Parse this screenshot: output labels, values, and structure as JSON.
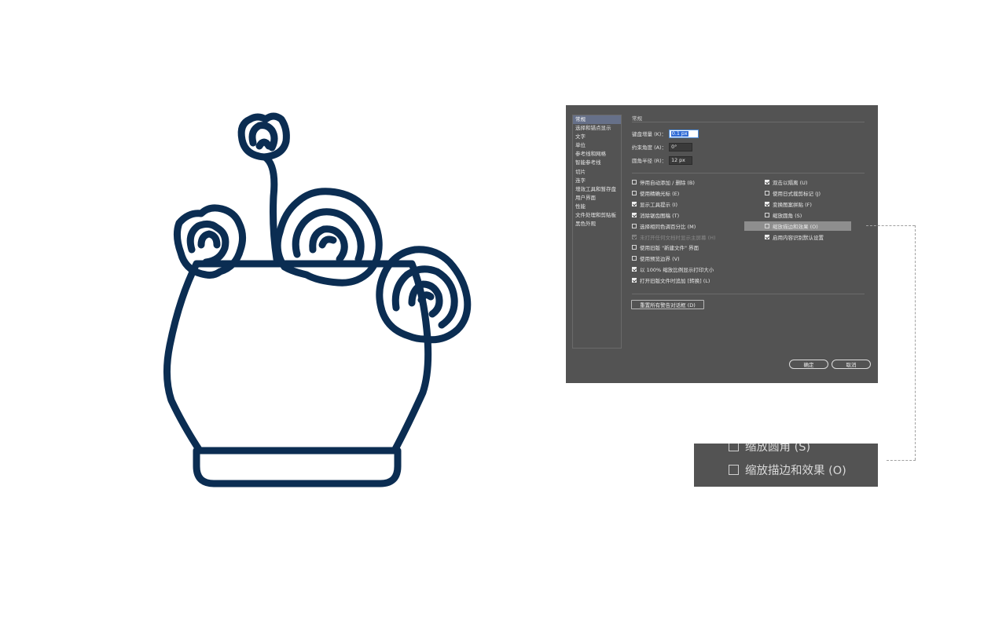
{
  "dialog": {
    "categories": [
      {
        "label": "常规",
        "selected": true
      },
      {
        "label": "选择和锚点显示",
        "selected": false
      },
      {
        "label": "文字",
        "selected": false
      },
      {
        "label": "单位",
        "selected": false
      },
      {
        "label": "参考线和网格",
        "selected": false
      },
      {
        "label": "智能参考线",
        "selected": false
      },
      {
        "label": "切片",
        "selected": false
      },
      {
        "label": "连字",
        "selected": false
      },
      {
        "label": "增效工具和暂存盘",
        "selected": false
      },
      {
        "label": "用户界面",
        "selected": false
      },
      {
        "label": "性能",
        "selected": false
      },
      {
        "label": "文件处理和剪贴板",
        "selected": false
      },
      {
        "label": "黑色外观",
        "selected": false
      }
    ],
    "section_title": "常规",
    "fields": {
      "keyboard_increment": {
        "label": "键盘增量 (K)：",
        "value": "0.1 px"
      },
      "constrain_angle": {
        "label": "约束角度 (A)：",
        "value": "0°"
      },
      "corner_radius": {
        "label": "圆角半径 (R)：",
        "value": "12 px"
      }
    },
    "options_left": [
      {
        "label": "停用自动添加 / 删除 (B)",
        "checked": false,
        "disabled": false
      },
      {
        "label": "使用精确光标 (E)",
        "checked": false,
        "disabled": false
      },
      {
        "label": "显示工具提示 (I)",
        "checked": true,
        "disabled": false
      },
      {
        "label": "消除锯齿图稿 (T)",
        "checked": true,
        "disabled": false
      },
      {
        "label": "选择相同色调百分比 (M)",
        "checked": false,
        "disabled": false
      },
      {
        "label": "未打开任何文档时显示主屏幕 (H)",
        "checked": true,
        "disabled": true
      },
      {
        "label": "使用旧版 \"新建文件\" 界面",
        "checked": false,
        "disabled": false
      },
      {
        "label": "使用预览边界 (V)",
        "checked": false,
        "disabled": false
      },
      {
        "label": "以 100% 缩放比例显示打印大小",
        "checked": true,
        "disabled": false
      },
      {
        "label": "打开旧版文件时追加 [转换] (L)",
        "checked": true,
        "disabled": false
      }
    ],
    "options_right": [
      {
        "label": "双击以隔离 (U)",
        "checked": true,
        "highlighted": false
      },
      {
        "label": "使用日式裁剪标记 (J)",
        "checked": false,
        "highlighted": false
      },
      {
        "label": "变换图案拼贴 (F)",
        "checked": true,
        "highlighted": false
      },
      {
        "label": "缩放圆角 (S)",
        "checked": false,
        "highlighted": false
      },
      {
        "label": "缩放描边和效果 (O)",
        "checked": false,
        "highlighted": true
      },
      {
        "label": "启用内容识别默认设置",
        "checked": true,
        "highlighted": false
      }
    ],
    "reset_button": "重置所有警告对话框 (D)",
    "ok_button": "确定",
    "cancel_button": "取消"
  },
  "zoom_callout": {
    "row_partial": "缩放圆角 (S)",
    "row_main": "缩放描边和效果 (O)"
  },
  "colors": {
    "plant_stroke": "#0b2d52",
    "dialog_bg": "#535353",
    "selected_category": "#667089",
    "highlight_row": "#8e8e8e"
  }
}
